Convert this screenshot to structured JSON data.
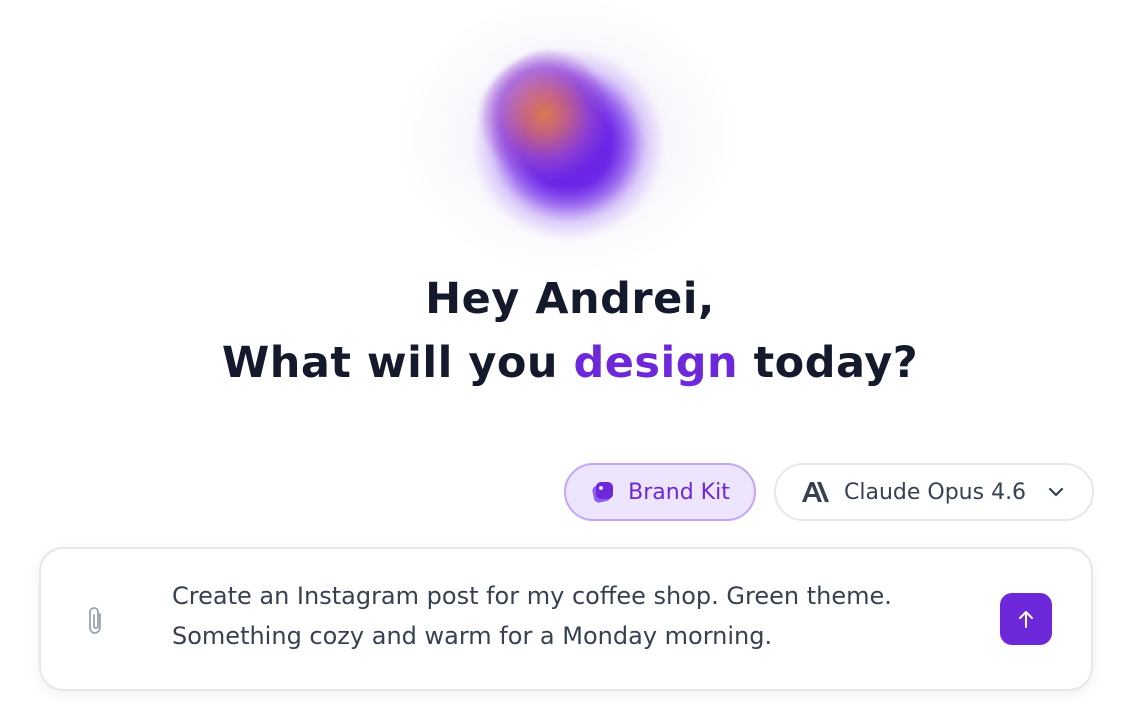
{
  "greeting": {
    "line1": "Hey Andrei,",
    "line2_before": "What will you ",
    "line2_accent": "design",
    "line2_after": " today?"
  },
  "brand_kit": {
    "label": "Brand Kit",
    "icon": "brand-kit-icon"
  },
  "model_selector": {
    "label": "Claude Opus 4.6",
    "icon": "anthropic-logo-icon",
    "chevron": "chevron-down-icon"
  },
  "prompt": {
    "text": "Create an Instagram post for my coffee shop. Green theme. Something cozy and warm for a Monday morning.",
    "attach_icon": "paperclip-icon",
    "send_icon": "arrow-up-icon"
  },
  "colors": {
    "accent": "#6d28d9",
    "brand_kit_bg": "#ede4fe",
    "heading": "#141a2c"
  }
}
